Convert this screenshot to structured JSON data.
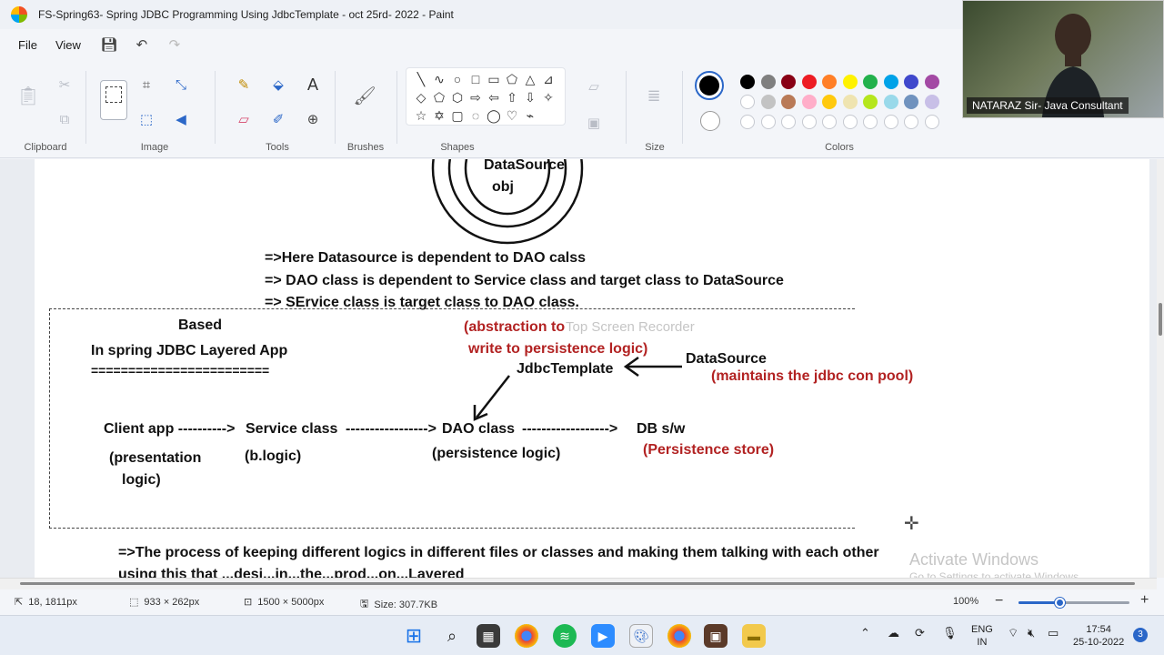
{
  "window": {
    "title": "FS-Spring63-  Spring JDBC Programming Using JdbcTemplate - oct 25rd- 2022 - Paint"
  },
  "menu": {
    "file": "File",
    "view": "View"
  },
  "ribbon": {
    "groups": {
      "clipboard": "Clipboard",
      "image": "Image",
      "tools": "Tools",
      "brushes": "Brushes",
      "shapes": "Shapes",
      "size": "Size",
      "colors": "Colors"
    },
    "tools_icons": {
      "pencil": "✎",
      "fill": "⬙",
      "text": "A",
      "eraser": "▱",
      "picker": "✐",
      "magnifier": "⊕"
    },
    "shape_glyphs": [
      "╲",
      "∿",
      "○",
      "□",
      "▭",
      "⬠",
      "△",
      "⊿",
      "◇",
      "⬠",
      "⬡",
      "⇨",
      "⇦",
      "⇧",
      "⇩",
      "✧",
      "☆",
      "✡",
      "▢",
      "◌",
      "◯",
      "♡",
      "⌁"
    ],
    "palette": {
      "row1": [
        "#000000",
        "#7f7f7f",
        "#880015",
        "#ed1c24",
        "#ff7f27",
        "#fff200",
        "#22b14c",
        "#00a2e8",
        "#3f48cc",
        "#a349a4"
      ],
      "row2": [
        "#ffffff",
        "#c3c3c3",
        "#b97a57",
        "#ffaec9",
        "#ffc90e",
        "#efe4b0",
        "#b5e61d",
        "#99d9ea",
        "#7092be",
        "#c8bfe7"
      ],
      "primary": "#000000",
      "secondary": "#ffffff"
    }
  },
  "canvas": {
    "top_circle_text": [
      "DataSource",
      "obj"
    ],
    "notes": {
      "line1": "=>Here  Datasource is dependent to   DAO calss",
      "line2": "=> DAO class  is  dependent  to Service class and  target class to  DataSource",
      "line3": "=> SErvice class is  target class to  DAO class."
    },
    "box": {
      "based": "Based",
      "heading": "In spring JDBC Layered App",
      "underline": "========================",
      "abstraction1": "(abstraction to",
      "abstraction2": "write to persistence logic)",
      "jdbc_template": "JdbcTemplate",
      "datasource": "DataSource",
      "datasource_note": "(maintains the jdbc con pool)",
      "flow": {
        "client": "Client app ---------->",
        "service": "Service class",
        "dashes1": "----------------->",
        "dao": "DAO class",
        "dashes2": "------------------>",
        "db": "DB s/w"
      },
      "presentation1": "(presentation",
      "presentation2": "logic)",
      "blogic": "(b.logic)",
      "persistence": "(persistence logic)",
      "persistence_store": "(Persistence store)"
    },
    "bottom_line": "=>The process of keeping different logics in different files or classes  and making them talking with each other",
    "bottom_line_cut": "using this that ...desi...in...the...prod...on...Layered",
    "watermark_recorder": "Top Screen Recorder",
    "watermark_activate": "Activate Windows",
    "watermark_activate_sub": "Go to Settings to activate Windows."
  },
  "status": {
    "cursor": "18, 1811px",
    "selection": "933 × 262px",
    "canvas_size": "1500 × 5000px",
    "file_size": "Size: 307.7KB",
    "zoom": "100%",
    "zoom_level": 0.38
  },
  "webcam": {
    "label": "NATARAZ Sir- Java Consultant"
  },
  "taskbar": {
    "lang1": "ENG",
    "lang2": "IN",
    "time": "17:54",
    "date": "25-10-2022",
    "notif_count": "3"
  }
}
